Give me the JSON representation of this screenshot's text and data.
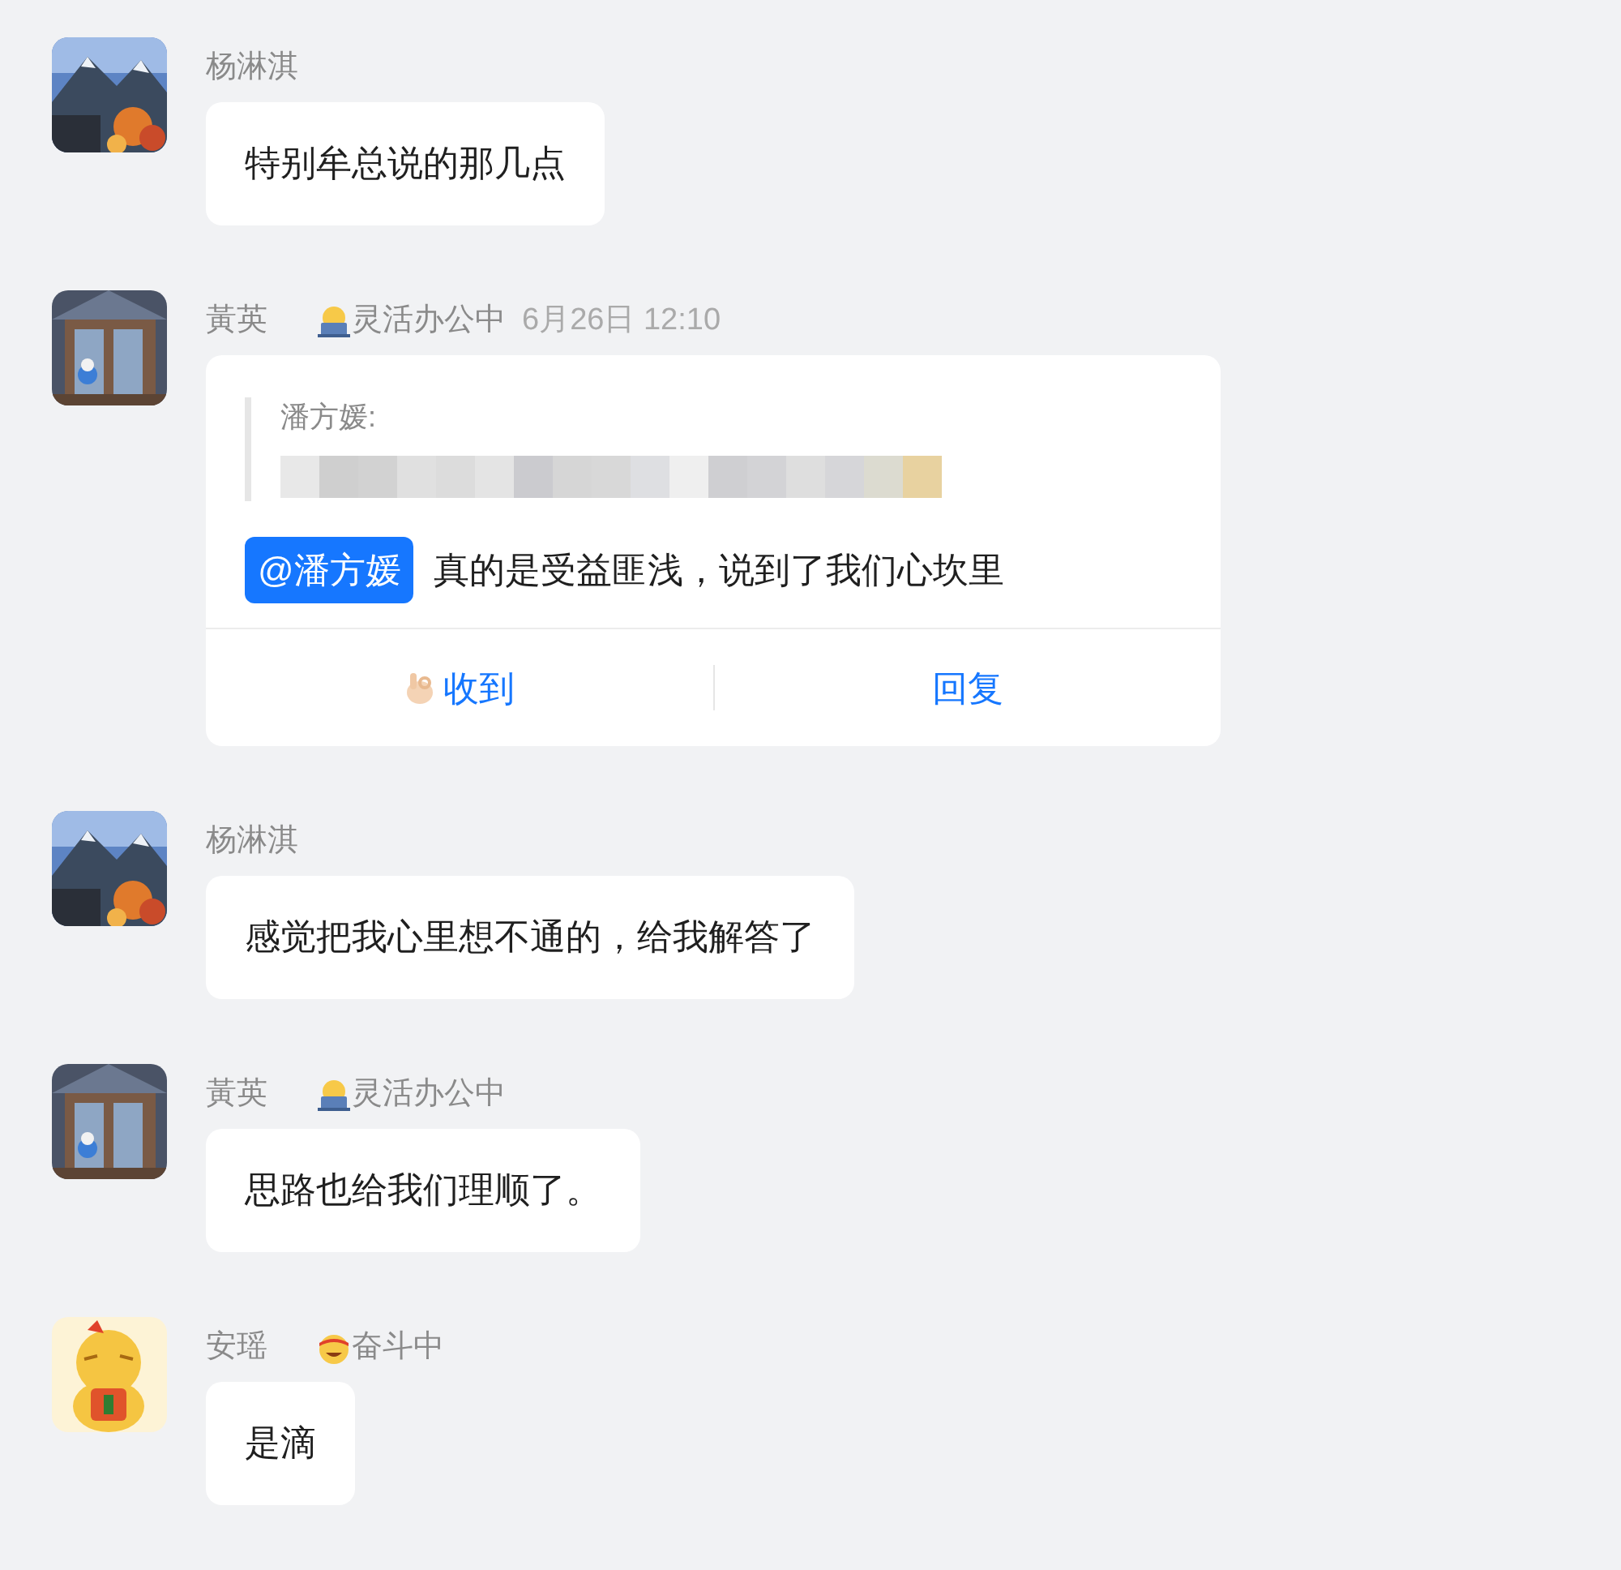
{
  "messages": [
    {
      "sender": "杨淋淇",
      "kind": "text",
      "text": "特别牟总说的那几点"
    },
    {
      "sender": "黃英",
      "status": {
        "kind": "laptop",
        "text": "灵活办公中"
      },
      "time": "6月26日 12:10",
      "kind": "card",
      "quote": {
        "author": "潘方媛:",
        "redacted": true
      },
      "mention": "@潘方媛",
      "text": "真的是受益匪浅，说到了我们心坎里",
      "actions": [
        {
          "kind": "ack",
          "label": "收到"
        },
        {
          "kind": "reply",
          "label": "回复"
        }
      ]
    },
    {
      "sender": "杨淋淇",
      "kind": "text",
      "text": "感觉把我心里想不通的，给我解答了"
    },
    {
      "sender": "黃英",
      "status": {
        "kind": "laptop",
        "text": "灵活办公中"
      },
      "kind": "text",
      "text": "思路也给我们理顺了。"
    },
    {
      "sender": "安瑶",
      "status": {
        "kind": "headband",
        "text": "奋斗中"
      },
      "kind": "text",
      "text": "是滴"
    }
  ]
}
